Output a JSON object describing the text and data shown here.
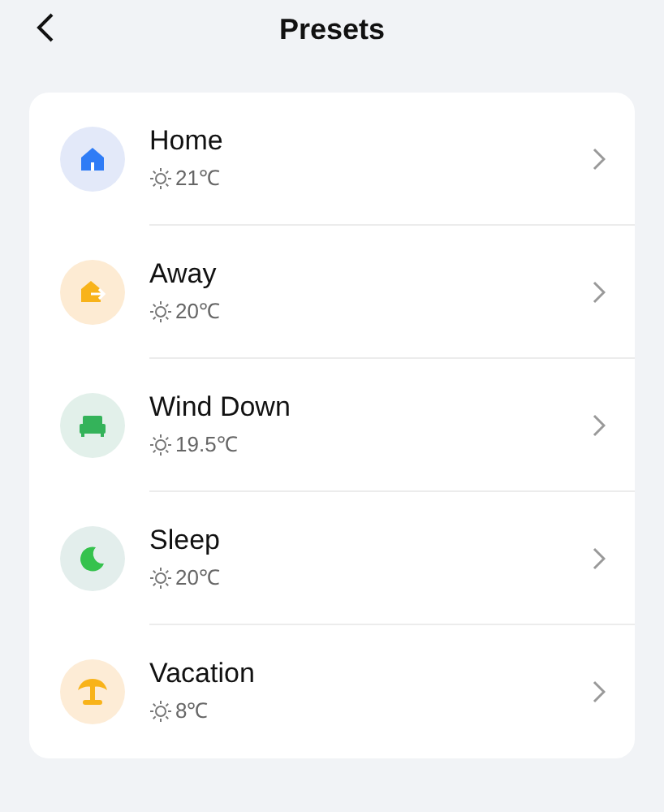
{
  "header": {
    "title": "Presets"
  },
  "presets": [
    {
      "name": "Home",
      "temperature": "21℃",
      "kind": "home",
      "color": "#2f7cf6"
    },
    {
      "name": "Away",
      "temperature": "20℃",
      "kind": "away",
      "color": "#f8b31a"
    },
    {
      "name": "Wind Down",
      "temperature": "19.5℃",
      "kind": "bed",
      "color": "#34b35a"
    },
    {
      "name": "Sleep",
      "temperature": "20℃",
      "kind": "moon",
      "color": "#35c24d"
    },
    {
      "name": "Vacation",
      "temperature": "8℃",
      "kind": "palm",
      "color": "#f8b31a"
    }
  ]
}
